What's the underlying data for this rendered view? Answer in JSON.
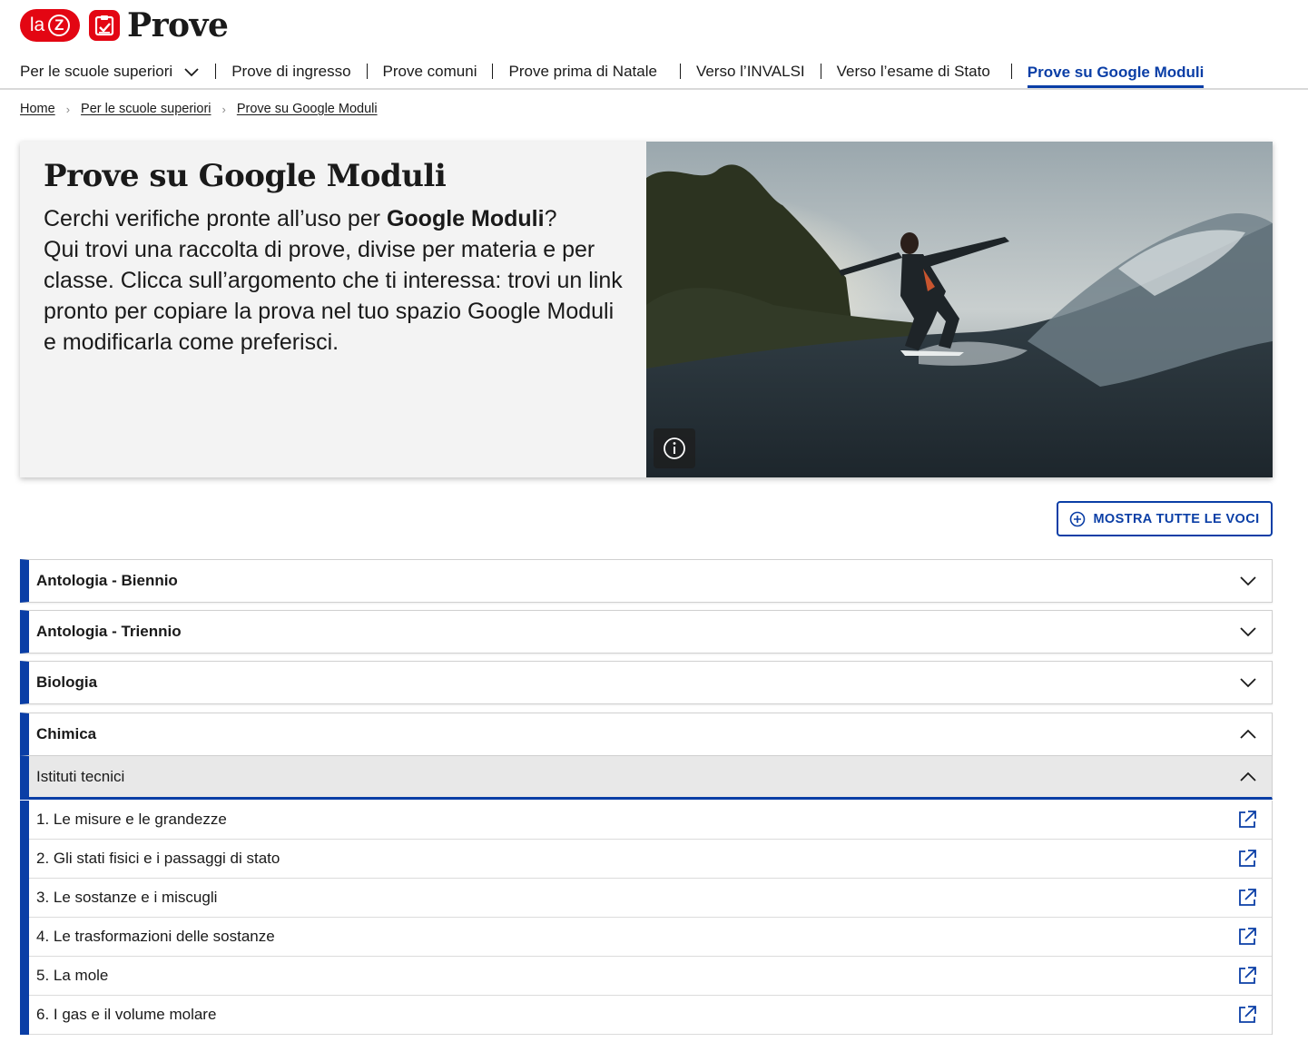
{
  "brand": {
    "badge_la": "la",
    "badge_z": "Z",
    "name": "Prove"
  },
  "nav": {
    "items": [
      {
        "label": "Per le scuole superiori",
        "has_dropdown": true
      },
      {
        "label": "Prove di ingresso"
      },
      {
        "label": "Prove comuni"
      },
      {
        "label": "Prove prima di Natale"
      },
      {
        "label": "Verso l’INVALSI"
      },
      {
        "label": "Verso l’esame di Stato"
      },
      {
        "label": "Prove su Google Moduli",
        "active": true
      }
    ]
  },
  "breadcrumb": [
    "Home",
    "Per le scuole superiori",
    "Prove su Google Moduli"
  ],
  "hero": {
    "title": "Prove su Google Moduli",
    "intro_before": "Cerchi verifiche pronte all’uso per ",
    "intro_bold": "Google Moduli",
    "intro_after": "?",
    "body": "Qui trovi una raccolta di prove, divise per materia e per classe. Clicca sull’argomento che ti interessa: trovi un link pronto per copiare la prova nel tuo spazio Google Moduli e modificarla come preferisci."
  },
  "actions": {
    "show_all": "MOSTRA TUTTE LE VOCI"
  },
  "accordion": [
    {
      "label": "Antologia - Biennio",
      "expanded": false
    },
    {
      "label": "Antologia - Triennio",
      "expanded": false
    },
    {
      "label": "Biologia",
      "expanded": false
    },
    {
      "label": "Chimica",
      "expanded": true
    }
  ],
  "subsection": {
    "label": "Istituti tecnici",
    "expanded": true
  },
  "topics": [
    "1. Le misure e le grandezze",
    "2. Gli stati fisici e i passaggi di stato",
    "3. Le sostanze e i miscugli",
    "4. Le trasformazioni delle sostanze",
    "5. La mole",
    "6. I gas e il volume molare"
  ],
  "colors": {
    "brand_red": "#e30613",
    "accent_blue": "#0a3ea6"
  }
}
